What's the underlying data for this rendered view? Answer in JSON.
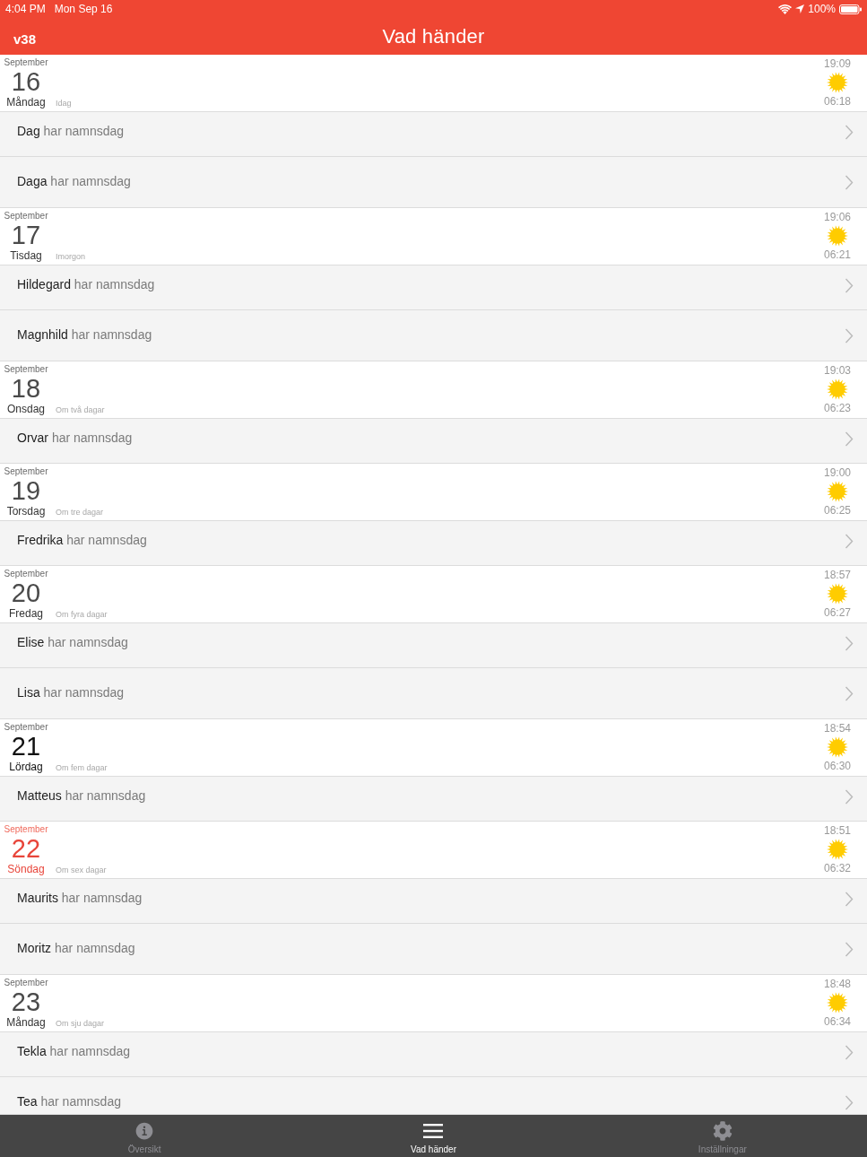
{
  "status_bar": {
    "time": "4:04 PM",
    "date": "Mon Sep 16",
    "battery": "100%"
  },
  "nav_bar": {
    "version": "v38",
    "title": "Vad händer"
  },
  "days": [
    {
      "kind": "weekday",
      "month": "September",
      "day": "16",
      "weekday": "Måndag",
      "relative": "Idag",
      "sunset": "19:09",
      "sunrise": "06:18",
      "names": [
        {
          "name": "Dag",
          "text": "har namnsdag"
        },
        {
          "name": "Daga",
          "text": "har namnsdag"
        }
      ]
    },
    {
      "kind": "weekday",
      "month": "September",
      "day": "17",
      "weekday": "Tisdag",
      "relative": "Imorgon",
      "sunset": "19:06",
      "sunrise": "06:21",
      "names": [
        {
          "name": "Hildegard",
          "text": "har namnsdag"
        },
        {
          "name": "Magnhild",
          "text": "har namnsdag"
        }
      ]
    },
    {
      "kind": "weekday",
      "month": "September",
      "day": "18",
      "weekday": "Onsdag",
      "relative": "Om två dagar",
      "sunset": "19:03",
      "sunrise": "06:23",
      "names": [
        {
          "name": "Orvar",
          "text": "har namnsdag"
        }
      ]
    },
    {
      "kind": "weekday",
      "month": "September",
      "day": "19",
      "weekday": "Torsdag",
      "relative": "Om tre dagar",
      "sunset": "19:00",
      "sunrise": "06:25",
      "names": [
        {
          "name": "Fredrika",
          "text": "har namnsdag"
        }
      ]
    },
    {
      "kind": "weekday",
      "month": "September",
      "day": "20",
      "weekday": "Fredag",
      "relative": "Om fyra dagar",
      "sunset": "18:57",
      "sunrise": "06:27",
      "names": [
        {
          "name": "Elise",
          "text": "har namnsdag"
        },
        {
          "name": "Lisa",
          "text": "har namnsdag"
        }
      ]
    },
    {
      "kind": "saturday",
      "month": "September",
      "day": "21",
      "weekday": "Lördag",
      "relative": "Om fem dagar",
      "sunset": "18:54",
      "sunrise": "06:30",
      "names": [
        {
          "name": "Matteus",
          "text": "har namnsdag"
        }
      ]
    },
    {
      "kind": "sunday",
      "month": "September",
      "day": "22",
      "weekday": "Söndag",
      "relative": "Om sex dagar",
      "sunset": "18:51",
      "sunrise": "06:32",
      "names": [
        {
          "name": "Maurits",
          "text": "har namnsdag"
        },
        {
          "name": "Moritz",
          "text": "har namnsdag"
        }
      ]
    },
    {
      "kind": "weekday",
      "month": "September",
      "day": "23",
      "weekday": "Måndag",
      "relative": "Om sju dagar",
      "sunset": "18:48",
      "sunrise": "06:34",
      "names": [
        {
          "name": "Tekla",
          "text": "har namnsdag"
        },
        {
          "name": "Tea",
          "text": "har namnsdag"
        }
      ]
    }
  ],
  "tab_bar": {
    "tabs": [
      {
        "label": "Översikt",
        "selected": false
      },
      {
        "label": "Vad händer",
        "selected": true
      },
      {
        "label": "Inställningar",
        "selected": false
      }
    ]
  }
}
